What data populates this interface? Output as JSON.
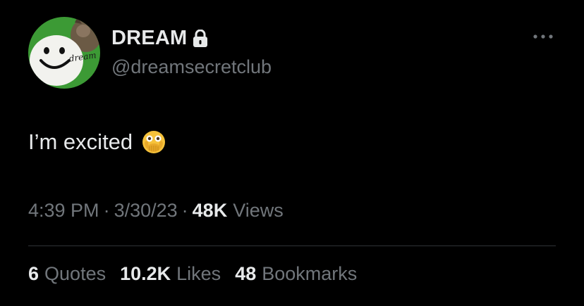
{
  "tweet": {
    "author": {
      "display_name": "DREAM",
      "handle": "@dreamsecretclub",
      "verified_icon": "lock-icon",
      "avatar_text": "dream"
    },
    "text": "I’m excited",
    "emoji": "face-with-open-eyes-and-hand-over-mouth",
    "time": "4:39 PM",
    "separator": "·",
    "date": "3/30/23",
    "views_count": "48K",
    "views_label": "Views",
    "stats": {
      "quotes_count": "6",
      "quotes_label": "Quotes",
      "likes_count": "10.2K",
      "likes_label": "Likes",
      "bookmarks_count": "48",
      "bookmarks_label": "Bookmarks"
    }
  },
  "colors": {
    "background": "#000000",
    "primary_text": "#e7e9ea",
    "secondary_text": "#71767b",
    "divider": "#2f3336",
    "avatar_green": "#3c9a35"
  }
}
